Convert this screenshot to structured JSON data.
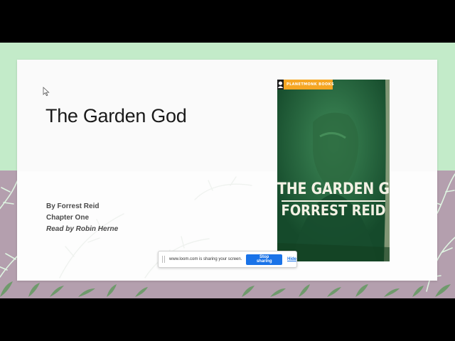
{
  "slide": {
    "title": "The Garden God",
    "author_line": "By Forrest Reid",
    "chapter_line": "Chapter One",
    "narrator_line": "Read by Robin Herne"
  },
  "cover": {
    "publisher": "PLANETMONK BOOKS",
    "title": "THE GARDEN GOD",
    "author": "FORREST REID"
  },
  "share_bar": {
    "message": "www.loom.com is sharing your screen.",
    "stop_label": "Stop sharing",
    "hide_label": "Hide"
  },
  "colors": {
    "backdrop_green": "#c3ebc9",
    "backdrop_mauve": "#b49fae",
    "cover_green": "#1f6b3f",
    "publisher_orange": "#f5a623",
    "stop_button_blue": "#1a73e8"
  }
}
